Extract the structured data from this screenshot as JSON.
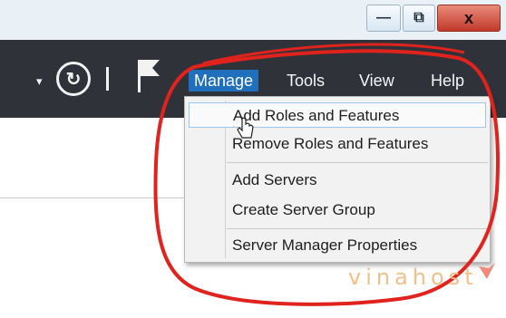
{
  "window": {
    "min_glyph": "—",
    "max_glyph": "⧉",
    "close_glyph": "x"
  },
  "toolbar": {
    "dropdown_caret": "▾",
    "refresh_glyph": "↻",
    "flag_icon": "flag-icon"
  },
  "menu": {
    "items": [
      {
        "label": "Manage",
        "active": true
      },
      {
        "label": "Tools"
      },
      {
        "label": "View"
      },
      {
        "label": "Help"
      }
    ]
  },
  "manage_menu": {
    "groups": [
      [
        "Add Roles and Features",
        "Remove Roles and Features"
      ],
      [
        "Add Servers",
        "Create Server Group"
      ],
      [
        "Server Manager Properties"
      ]
    ],
    "hovered": "Add Roles and Features"
  },
  "watermark": {
    "text": "vinahost"
  },
  "colors": {
    "menubar": "#2f3339",
    "active_menu": "#1f6fbd",
    "annotation": "#e0231c",
    "close_button": "#c0392b"
  }
}
